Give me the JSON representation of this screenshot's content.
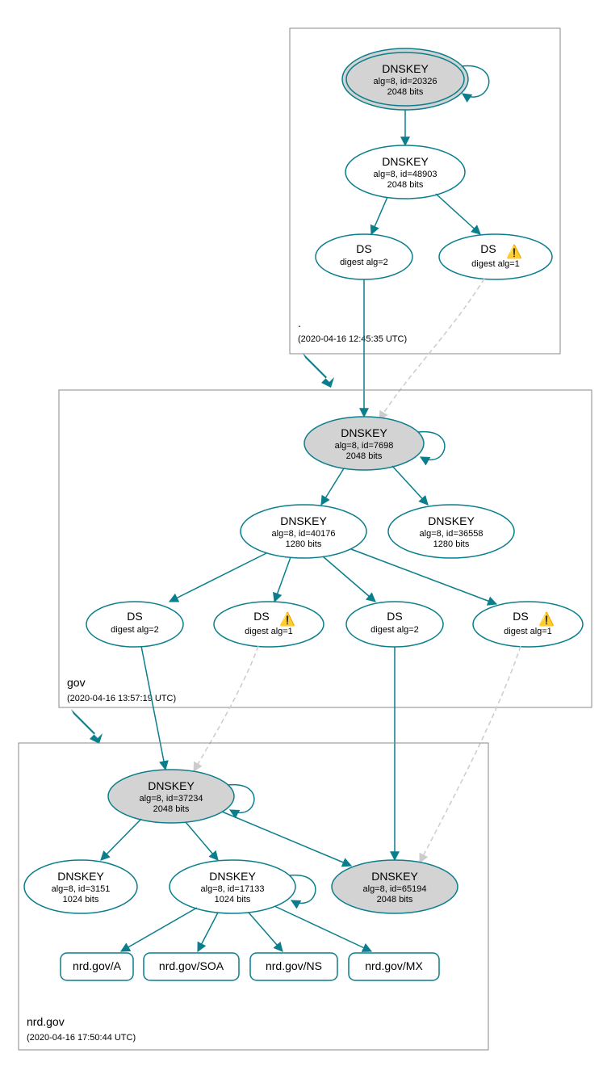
{
  "zones": {
    "root": {
      "label": ".",
      "timestamp": "(2020-04-16 12:45:35 UTC)",
      "nodes": {
        "ksk": {
          "title": "DNSKEY",
          "line2": "alg=8, id=20326",
          "line3": "2048 bits"
        },
        "zsk": {
          "title": "DNSKEY",
          "line2": "alg=8, id=48903",
          "line3": "2048 bits"
        },
        "ds2": {
          "title": "DS",
          "line2": "digest alg=2"
        },
        "ds1": {
          "title": "DS",
          "line2": "digest alg=1",
          "warn": "⚠️"
        }
      }
    },
    "gov": {
      "label": "gov",
      "timestamp": "(2020-04-16 13:57:19 UTC)",
      "nodes": {
        "ksk": {
          "title": "DNSKEY",
          "line2": "alg=8, id=7698",
          "line3": "2048 bits"
        },
        "zsk1": {
          "title": "DNSKEY",
          "line2": "alg=8, id=40176",
          "line3": "1280 bits"
        },
        "zsk2": {
          "title": "DNSKEY",
          "line2": "alg=8, id=36558",
          "line3": "1280 bits"
        },
        "ds2a": {
          "title": "DS",
          "line2": "digest alg=2"
        },
        "ds1a": {
          "title": "DS",
          "line2": "digest alg=1",
          "warn": "⚠️"
        },
        "ds2b": {
          "title": "DS",
          "line2": "digest alg=2"
        },
        "ds1b": {
          "title": "DS",
          "line2": "digest alg=1",
          "warn": "⚠️"
        }
      }
    },
    "nrd": {
      "label": "nrd.gov",
      "timestamp": "(2020-04-16 17:50:44 UTC)",
      "nodes": {
        "ksk": {
          "title": "DNSKEY",
          "line2": "alg=8, id=37234",
          "line3": "2048 bits"
        },
        "zsk1": {
          "title": "DNSKEY",
          "line2": "alg=8, id=3151",
          "line3": "1024 bits"
        },
        "zsk2": {
          "title": "DNSKEY",
          "line2": "alg=8, id=17133",
          "line3": "1024 bits"
        },
        "ksk2": {
          "title": "DNSKEY",
          "line2": "alg=8, id=65194",
          "line3": "2048 bits"
        }
      },
      "records": {
        "a": "nrd.gov/A",
        "soa": "nrd.gov/SOA",
        "ns": "nrd.gov/NS",
        "mx": "nrd.gov/MX"
      }
    }
  }
}
